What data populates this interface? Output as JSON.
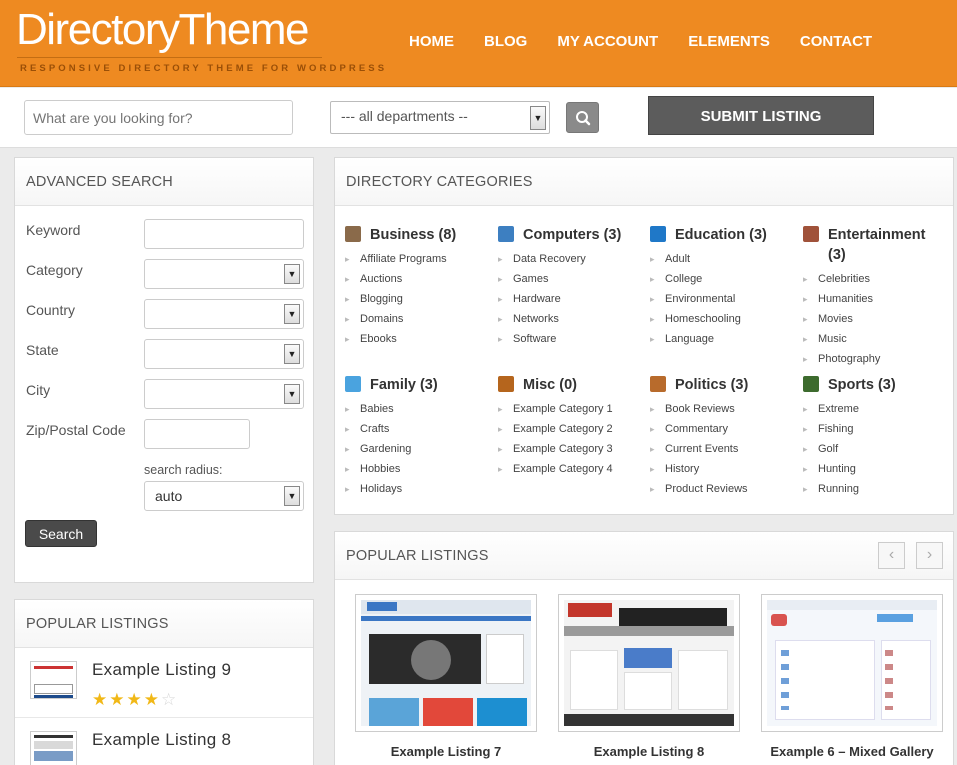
{
  "header": {
    "logo": "DirectoryTheme",
    "tagline": "RESPONSIVE DIRECTORY THEME FOR WORDPRESS",
    "nav": [
      "HOME",
      "BLOG",
      "MY ACCOUNT",
      "ELEMENTS",
      "CONTACT"
    ]
  },
  "searchbar": {
    "placeholder": "What are you looking for?",
    "department": "--- all departments --",
    "submit_label": "SUBMIT LISTING"
  },
  "advanced_search": {
    "title": "ADVANCED SEARCH",
    "keyword_label": "Keyword",
    "category_label": "Category",
    "country_label": "Country",
    "state_label": "State",
    "city_label": "City",
    "zip_label": "Zip/Postal Code",
    "radius_label": "search radius:",
    "radius_value": "auto",
    "search_button": "Search"
  },
  "popular_left": {
    "title": "POPULAR LISTINGS",
    "items": [
      {
        "title": "Example Listing 9",
        "rating": 4,
        "max_rating": 5
      },
      {
        "title": "Example Listing 8"
      }
    ]
  },
  "categories": {
    "title": "DIRECTORY CATEGORIES",
    "items": [
      {
        "name": "Business (8)",
        "icon": "coffee-cup-icon",
        "color": "#8a6a4a",
        "children": [
          "Affiliate Programs",
          "Auctions",
          "Blogging",
          "Domains",
          "Ebooks"
        ]
      },
      {
        "name": "Computers (3)",
        "icon": "monitor-icon",
        "color": "#3d7fc1",
        "children": [
          "Data Recovery",
          "Games",
          "Hardware",
          "Networks",
          "Software"
        ]
      },
      {
        "name": "Education (3)",
        "icon": "browser-e-icon",
        "color": "#1f78c8",
        "children": [
          "Adult",
          "College",
          "Environmental",
          "Homeschooling",
          "Language"
        ]
      },
      {
        "name": "Entertainment (3)",
        "icon": "stamp-icon",
        "color": "#a0523a",
        "children": [
          "Celebrities",
          "Humanities",
          "Movies",
          "Music",
          "Photography"
        ]
      },
      {
        "name": "Family (3)",
        "icon": "speech-bubble-icon",
        "color": "#4aa3df",
        "children": [
          "Babies",
          "Crafts",
          "Gardening",
          "Hobbies",
          "Holidays"
        ]
      },
      {
        "name": "Misc (0)",
        "icon": "bug-icon",
        "color": "#b5651d",
        "children": [
          "Example Category 1",
          "Example Category 2",
          "Example Category 3",
          "Example Category 4"
        ]
      },
      {
        "name": "Politics (3)",
        "icon": "gavel-icon",
        "color": "#b86b2c",
        "children": [
          "Book Reviews",
          "Commentary",
          "Current Events",
          "History",
          "Product Reviews"
        ]
      },
      {
        "name": "Sports (3)",
        "icon": "scoreboard-icon",
        "color": "#3d6b2e",
        "children": [
          "Extreme",
          "Fishing",
          "Golf",
          "Hunting",
          "Running"
        ]
      }
    ]
  },
  "popular_right": {
    "title": "POPULAR LISTINGS",
    "prev": "‹",
    "next": "›",
    "cards": [
      {
        "title": "Example Listing 7"
      },
      {
        "title": "Example Listing 8"
      },
      {
        "title": "Example 6 – Mixed Gallery"
      }
    ]
  },
  "colors": {
    "brand": "#ee8a21",
    "dark_button": "#5c5c5c",
    "star": "#f1b817"
  }
}
